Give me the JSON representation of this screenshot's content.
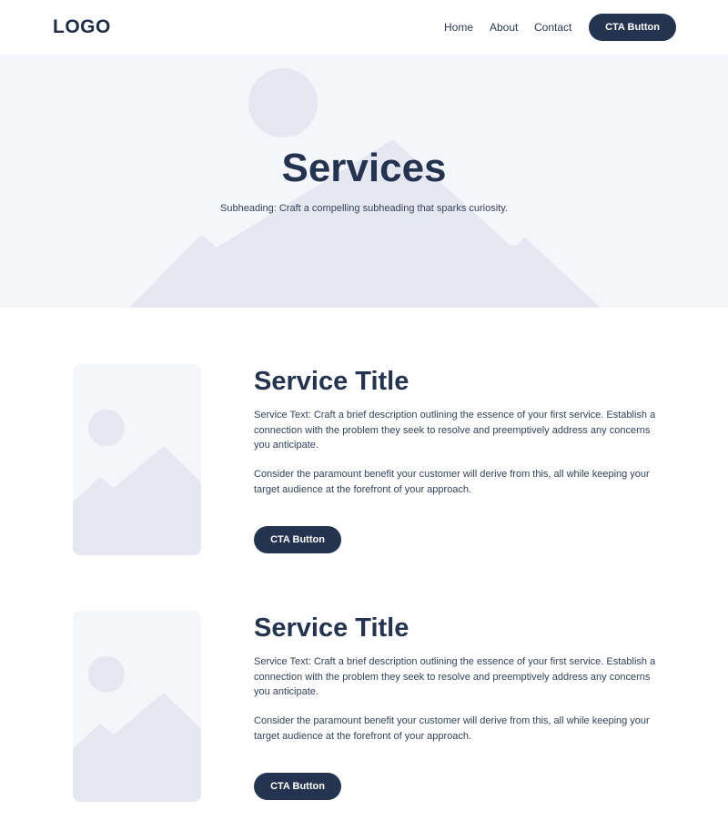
{
  "header": {
    "logo": "LOGO",
    "nav": [
      "Home",
      "About",
      "Contact"
    ],
    "cta_label": "CTA Button"
  },
  "hero": {
    "title": "Services",
    "subheading": "Subheading: Craft a compelling subheading that sparks curiosity."
  },
  "services": [
    {
      "title": "Service Title",
      "text1": "Service Text: Craft a brief description outlining the essence of your first service. Establish a connection with the problem they seek to resolve and preemptively address any concerns you anticipate.",
      "text2": "Consider the paramount benefit your customer will derive from this, all while keeping your target audience at the forefront of your approach.",
      "cta_label": "CTA Button"
    },
    {
      "title": "Service Title",
      "text1": "Service Text: Craft a brief description outlining the essence of your first service. Establish a connection with the problem they seek to resolve and preemptively address any concerns you anticipate.",
      "text2": "Consider the paramount benefit your customer will derive from this, all while keeping your target audience at the forefront of your approach.",
      "cta_label": "CTA Button"
    }
  ],
  "colors": {
    "primary": "#243450",
    "background_light": "#f5f6fa",
    "placeholder_shape": "#e6e8f1",
    "text": "#33425a"
  },
  "icons": {
    "hero_background": "image-placeholder-icon",
    "service_thumbnail": "image-placeholder-icon"
  }
}
